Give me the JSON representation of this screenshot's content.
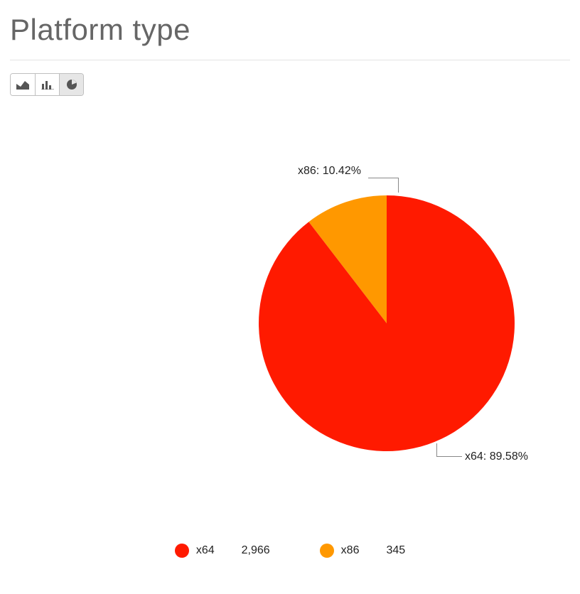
{
  "title": "Platform type",
  "toolbar": {
    "area_tooltip": "Area chart",
    "bar_tooltip": "Bar chart",
    "pie_tooltip": "Pie chart",
    "active": "pie"
  },
  "colors": {
    "x64": "#ff1a00",
    "x86": "#ff9800",
    "leader": "#888888"
  },
  "callouts": {
    "x86": "x86: 10.42%",
    "x64": "x64: 89.58%"
  },
  "legend": {
    "x64_label": "x64",
    "x64_value": "2,966",
    "x86_label": "x86",
    "x86_value": "345"
  },
  "chart_data": {
    "type": "pie",
    "title": "Platform type",
    "series": [
      {
        "name": "x64",
        "value": 2966,
        "percent": 89.58,
        "color": "#ff1a00"
      },
      {
        "name": "x86",
        "value": 345,
        "percent": 10.42,
        "color": "#ff9800"
      }
    ]
  }
}
